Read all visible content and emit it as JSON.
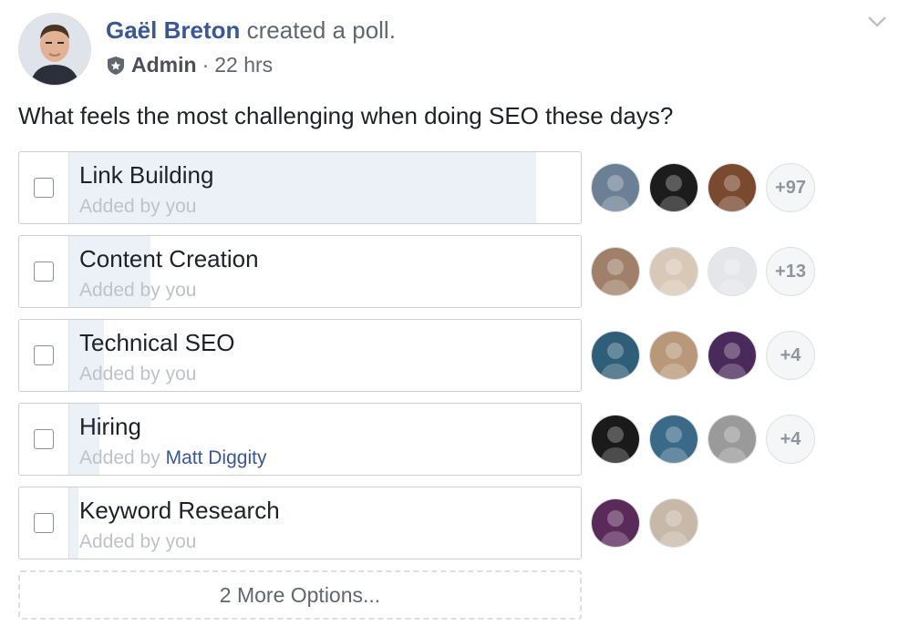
{
  "post": {
    "author": "Gaël Breton",
    "action": "created a poll.",
    "role": "Admin",
    "separator": "·",
    "time": "22 hrs",
    "question": "What feels the most challenging when doing SEO these days?"
  },
  "poll": {
    "options": [
      {
        "label": "Link Building",
        "added_prefix": "Added by",
        "added_by": "you",
        "fill_fraction": 0.91,
        "extra_votes": "+97",
        "voter_colors": [
          "#6b7f95",
          "#1c1c1c",
          "#7a4a30"
        ]
      },
      {
        "label": "Content Creation",
        "added_prefix": "Added by",
        "added_by": "you",
        "fill_fraction": 0.16,
        "extra_votes": "+13",
        "voter_colors": [
          "#a08068",
          "#d8c8b8",
          "#e4e6e9"
        ]
      },
      {
        "label": "Technical SEO",
        "added_prefix": "Added by",
        "added_by": "you",
        "fill_fraction": 0.07,
        "extra_votes": "+4",
        "voter_colors": [
          "#2f5e78",
          "#b89878",
          "#4a2a5a"
        ]
      },
      {
        "label": "Hiring",
        "added_prefix": "Added by",
        "added_by": "Matt Diggity",
        "fill_fraction": 0.06,
        "extra_votes": "+4",
        "voter_colors": [
          "#1a1a1a",
          "#3a6a88",
          "#9a9a9a"
        ]
      },
      {
        "label": "Keyword Research",
        "added_prefix": "Added by",
        "added_by": "you",
        "fill_fraction": 0.02,
        "extra_votes": "",
        "voter_colors": [
          "#5a2a5a",
          "#c8b8a8"
        ]
      }
    ],
    "more_options_label": "2 More Options..."
  },
  "colors": {
    "link_blue": "#385898",
    "vote_fill": "#ecf0f7",
    "muted_text": "#bec3c9"
  },
  "icons": {
    "admin_badge": "shield-icon",
    "menu": "chevron-down-icon"
  }
}
